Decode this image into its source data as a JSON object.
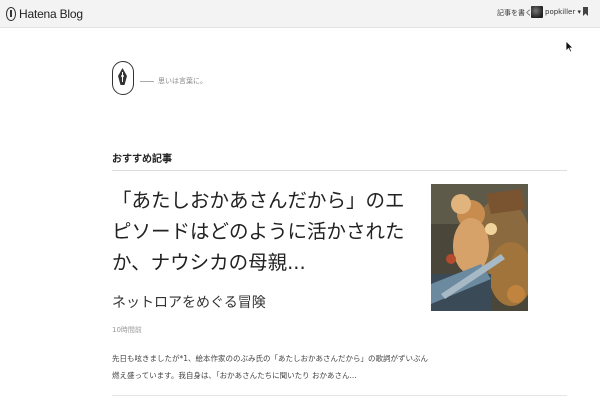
{
  "topbar": {
    "brand": "Hatena Blog",
    "write_label": "記事を書く",
    "username": "popkiller ▾"
  },
  "blog": {
    "tagline": "思いは言葉に。"
  },
  "recommended": {
    "heading": "おすすめ記事",
    "article": {
      "title": "「あたしおかあさんだから」のエピソードはどのように活かされたか、ナウシカの母親...",
      "blog_name": "ネットロアをめぐる冒険",
      "time": "10時間前",
      "excerpt": "先日も呟きましたが*1、絵本作家ののぶみ氏の「あたしおかあさんだから」の歌詞がずいぶん燃え盛っています。我自身は、「おかあさんたちに聞いたり おかあさん..."
    }
  }
}
